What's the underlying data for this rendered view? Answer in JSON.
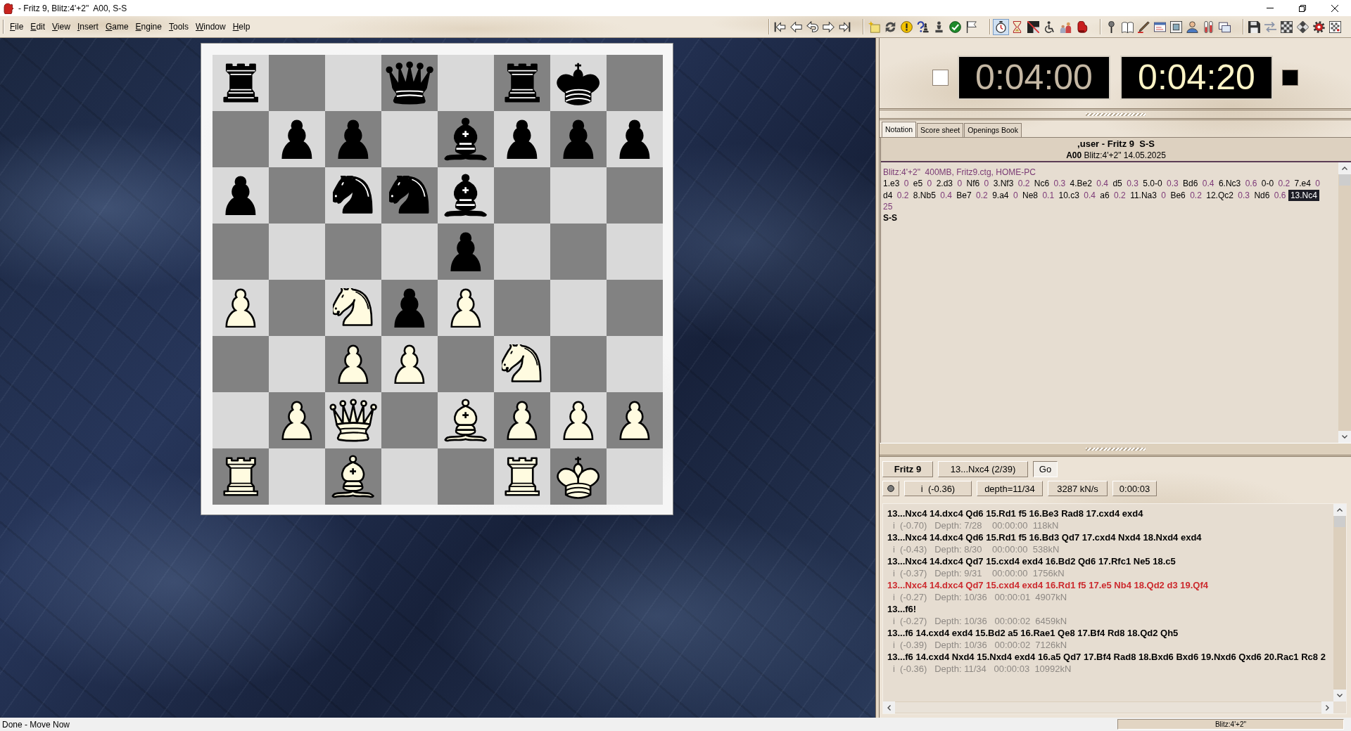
{
  "window": {
    "title": "- Fritz 9, Blitz:4'+2\"  A00, S-S"
  },
  "menu": [
    "File",
    "Edit",
    "View",
    "Insert",
    "Game",
    "Engine",
    "Tools",
    "Window",
    "Help"
  ],
  "toolbar": {
    "groups": [
      [
        {
          "kind": "first",
          "pressed": false
        },
        {
          "kind": "back",
          "pressed": false
        },
        {
          "kind": "takeback",
          "pressed": false
        },
        {
          "kind": "forward",
          "pressed": false
        },
        {
          "kind": "last",
          "pressed": false
        }
      ],
      [
        {
          "kind": "new",
          "pressed": false
        },
        {
          "kind": "cycle",
          "pressed": false
        },
        {
          "kind": "exclaim",
          "pressed": false
        },
        {
          "kind": "question",
          "pressed": false
        },
        {
          "kind": "figure",
          "pressed": false
        },
        {
          "kind": "check",
          "pressed": false
        },
        {
          "kind": "flag",
          "pressed": false
        }
      ],
      [
        {
          "kind": "stopwatch",
          "pressed": true
        },
        {
          "kind": "hourglass",
          "pressed": false
        },
        {
          "kind": "crossed",
          "pressed": false
        },
        {
          "kind": "wheelchair",
          "pressed": false
        },
        {
          "kind": "people",
          "pressed": false
        },
        {
          "kind": "glove",
          "pressed": false
        }
      ],
      [
        {
          "kind": "pin",
          "pressed": false
        },
        {
          "kind": "book",
          "pressed": false
        },
        {
          "kind": "pen",
          "pressed": false
        },
        {
          "kind": "card",
          "pressed": false
        },
        {
          "kind": "panel",
          "pressed": false
        },
        {
          "kind": "person",
          "pressed": false
        },
        {
          "kind": "tubes",
          "pressed": false
        },
        {
          "kind": "windows",
          "pressed": false
        }
      ],
      [
        {
          "kind": "floppy",
          "pressed": false
        },
        {
          "kind": "swap",
          "pressed": false
        },
        {
          "kind": "chessboard",
          "pressed": false
        },
        {
          "kind": "diamond",
          "pressed": false
        },
        {
          "kind": "gear",
          "pressed": false
        },
        {
          "kind": "framed",
          "pressed": false
        }
      ]
    ]
  },
  "board": {
    "ranks": [
      [
        {
          "kind": "rook",
          "black": true
        },
        {
          "kind": "empty"
        },
        {
          "kind": "empty"
        },
        {
          "kind": "queen",
          "black": true
        },
        {
          "kind": "empty"
        },
        {
          "kind": "rook",
          "black": true
        },
        {
          "kind": "king",
          "black": true
        },
        {
          "kind": "empty"
        }
      ],
      [
        {
          "kind": "empty"
        },
        {
          "kind": "pawn",
          "black": true
        },
        {
          "kind": "pawn",
          "black": true
        },
        {
          "kind": "empty"
        },
        {
          "kind": "bishop",
          "black": true
        },
        {
          "kind": "pawn",
          "black": true
        },
        {
          "kind": "pawn",
          "black": true
        },
        {
          "kind": "pawn",
          "black": true
        }
      ],
      [
        {
          "kind": "pawn",
          "black": true
        },
        {
          "kind": "empty"
        },
        {
          "kind": "knight",
          "black": true
        },
        {
          "kind": "knight",
          "black": true
        },
        {
          "kind": "bishop",
          "black": true
        },
        {
          "kind": "empty"
        },
        {
          "kind": "empty"
        },
        {
          "kind": "empty"
        }
      ],
      [
        {
          "kind": "empty"
        },
        {
          "kind": "empty"
        },
        {
          "kind": "empty"
        },
        {
          "kind": "empty"
        },
        {
          "kind": "pawn",
          "black": true
        },
        {
          "kind": "empty"
        },
        {
          "kind": "empty"
        },
        {
          "kind": "empty"
        }
      ],
      [
        {
          "kind": "pawn",
          "black": false
        },
        {
          "kind": "empty"
        },
        {
          "kind": "knight",
          "black": false
        },
        {
          "kind": "pawn",
          "black": true
        },
        {
          "kind": "pawn",
          "black": false
        },
        {
          "kind": "empty"
        },
        {
          "kind": "empty"
        },
        {
          "kind": "empty"
        }
      ],
      [
        {
          "kind": "empty"
        },
        {
          "kind": "empty"
        },
        {
          "kind": "pawn",
          "black": false
        },
        {
          "kind": "pawn",
          "black": false
        },
        {
          "kind": "empty"
        },
        {
          "kind": "knight",
          "black": false
        },
        {
          "kind": "empty"
        },
        {
          "kind": "empty"
        }
      ],
      [
        {
          "kind": "empty"
        },
        {
          "kind": "pawn",
          "black": false
        },
        {
          "kind": "queen",
          "black": false
        },
        {
          "kind": "empty"
        },
        {
          "kind": "bishop",
          "black": false
        },
        {
          "kind": "pawn",
          "black": false
        },
        {
          "kind": "pawn",
          "black": false
        },
        {
          "kind": "pawn",
          "black": false
        }
      ],
      [
        {
          "kind": "rook",
          "black": false
        },
        {
          "kind": "empty"
        },
        {
          "kind": "bishop",
          "black": false
        },
        {
          "kind": "empty"
        },
        {
          "kind": "empty"
        },
        {
          "kind": "rook",
          "black": false
        },
        {
          "kind": "king",
          "black": false
        },
        {
          "kind": "empty"
        }
      ]
    ]
  },
  "clocks": [
    {
      "time": "0:04:00",
      "color": "#ffffff",
      "running": false
    },
    {
      "time": "0:04:20",
      "color": "#000000",
      "running": true
    }
  ],
  "tabs": [
    {
      "label": "Notation",
      "selected": true
    },
    {
      "label": "Score sheet",
      "selected": false
    },
    {
      "label": "Openings Book",
      "selected": false
    }
  ],
  "notation": {
    "title": ",user - Fritz 9  S-S",
    "subtitle": "**A00** Blitz:4'+2\" 14.05.2025",
    "info": "Blitz:4'+2\"  400MB, Fritz9.ctg, HOME-PC",
    "lines": [
      [
        {
          "kind": "move",
          "text": "1.e3",
          "selected": false
        },
        {
          "kind": "eval",
          "text": "0"
        },
        {
          "kind": "move",
          "text": "e5",
          "selected": false
        },
        {
          "kind": "eval",
          "text": "0"
        },
        {
          "kind": "move",
          "text": "2.d3",
          "selected": false
        },
        {
          "kind": "eval",
          "text": "0"
        },
        {
          "kind": "move",
          "text": "Nf6",
          "selected": false
        },
        {
          "kind": "eval",
          "text": "0"
        },
        {
          "kind": "move",
          "text": "3.Nf3",
          "selected": false
        },
        {
          "kind": "eval",
          "text": "0.2"
        },
        {
          "kind": "move",
          "text": "Nc6",
          "selected": false
        },
        {
          "kind": "eval",
          "text": "0.3"
        },
        {
          "kind": "move",
          "text": "4.Be2",
          "selected": false
        },
        {
          "kind": "eval",
          "text": "0.4"
        },
        {
          "kind": "move",
          "text": "d5",
          "selected": false
        },
        {
          "kind": "eval",
          "text": "0.3"
        },
        {
          "kind": "move",
          "text": "5.0-0",
          "selected": false
        },
        {
          "kind": "eval",
          "text": "0.3"
        },
        {
          "kind": "move",
          "text": "Bd6",
          "selected": false
        },
        {
          "kind": "eval",
          "text": "0.4"
        },
        {
          "kind": "move",
          "text": "6.Nc3",
          "selected": false
        },
        {
          "kind": "eval",
          "text": "0.6"
        },
        {
          "kind": "move",
          "text": "0-0",
          "selected": false
        },
        {
          "kind": "eval",
          "text": "0.2"
        },
        {
          "kind": "move",
          "text": "7.e4",
          "selected": false
        },
        {
          "kind": "eval",
          "text": "0"
        }
      ],
      [
        {
          "kind": "move",
          "text": "d4",
          "selected": false
        },
        {
          "kind": "eval",
          "text": "0.2"
        },
        {
          "kind": "move",
          "text": "8.Nb5",
          "selected": false
        },
        {
          "kind": "eval",
          "text": "0.4"
        },
        {
          "kind": "move",
          "text": "Be7",
          "selected": false
        },
        {
          "kind": "eval",
          "text": "0.2"
        },
        {
          "kind": "move",
          "text": "9.a4",
          "selected": false
        },
        {
          "kind": "eval",
          "text": "0"
        },
        {
          "kind": "move",
          "text": "Ne8",
          "selected": false
        },
        {
          "kind": "eval",
          "text": "0.1"
        },
        {
          "kind": "move",
          "text": "10.c3",
          "selected": false
        },
        {
          "kind": "eval",
          "text": "0.4"
        },
        {
          "kind": "move",
          "text": "a6",
          "selected": false
        },
        {
          "kind": "eval",
          "text": "0.2"
        },
        {
          "kind": "move",
          "text": "11.Na3",
          "selected": false
        },
        {
          "kind": "eval",
          "text": "0"
        },
        {
          "kind": "move",
          "text": "Be6",
          "selected": false
        },
        {
          "kind": "eval",
          "text": "0.2"
        },
        {
          "kind": "move",
          "text": "12.Qc2",
          "selected": false
        },
        {
          "kind": "eval",
          "text": "0.3"
        },
        {
          "kind": "move",
          "text": "Nd6",
          "selected": false
        },
        {
          "kind": "eval",
          "text": "0.6"
        },
        {
          "kind": "move",
          "text": "13.Nc4",
          "selected": true
        }
      ],
      [
        {
          "kind": "eval",
          "text": "25"
        }
      ]
    ],
    "result": "S-S"
  },
  "engine": {
    "name": "Fritz 9",
    "current_move": "13...Nxc4 (2/39)",
    "go_label": "Go",
    "evaluation": "i  (-0.36)",
    "depth": "depth=11/34",
    "speed": "3287 kN/s",
    "time": "0:00:03",
    "lines": [
      {
        "moves": "13...Nxc4 14.dxc4 Qd6 15.Rd1 f5 16.Be3 Rad8 17.cxd4 exd4",
        "info": "i  (-0.70)   Depth: 7/28    00:00:00  118kN",
        "highlighted": false
      },
      {
        "moves": "13...Nxc4 14.dxc4 Qd6 15.Rd1 f5 16.Bd3 Qd7 17.cxd4 Nxd4 18.Nxd4 exd4",
        "info": "i  (-0.43)   Depth: 8/30    00:00:00  538kN",
        "highlighted": false
      },
      {
        "moves": "13...Nxc4 14.dxc4 Qd7 15.cxd4 exd4 16.Bd2 Qd6 17.Rfc1 Ne5 18.c5",
        "info": "i  (-0.37)   Depth: 9/31    00:00:00  1756kN",
        "highlighted": false
      },
      {
        "moves": "13...Nxc4 14.dxc4 Qd7 15.cxd4 exd4 16.Rd1 f5 17.e5 Nb4 18.Qd2 d3 19.Qf4",
        "info": "i  (-0.27)   Depth: 10/36   00:00:01  4907kN",
        "highlighted": true
      },
      {
        "moves": "13...f6!",
        "info": "i  (-0.27)   Depth: 10/36   00:00:02  6459kN",
        "highlighted": false
      },
      {
        "moves": "13...f6 14.cxd4 exd4 15.Bd2 a5 16.Rae1 Qe8 17.Bf4 Rd8 18.Qd2 Qh5",
        "info": "i  (-0.39)   Depth: 10/36   00:00:02  7126kN",
        "highlighted": false
      },
      {
        "moves": "13...f6 14.cxd4 Nxd4 15.Nxd4 exd4 16.a5 Qd7 17.Bf4 Rad8 18.Bxd6 Bxd6 19.Nxd6 Qxd6 20.Rac1 Rc8 2",
        "info": "i  (-0.36)   Depth: 11/34   00:00:03  10992kN",
        "highlighted": false
      }
    ]
  },
  "status_bar": {
    "message": "Done - Move Now",
    "panel": "Blitz:4'+2\""
  }
}
